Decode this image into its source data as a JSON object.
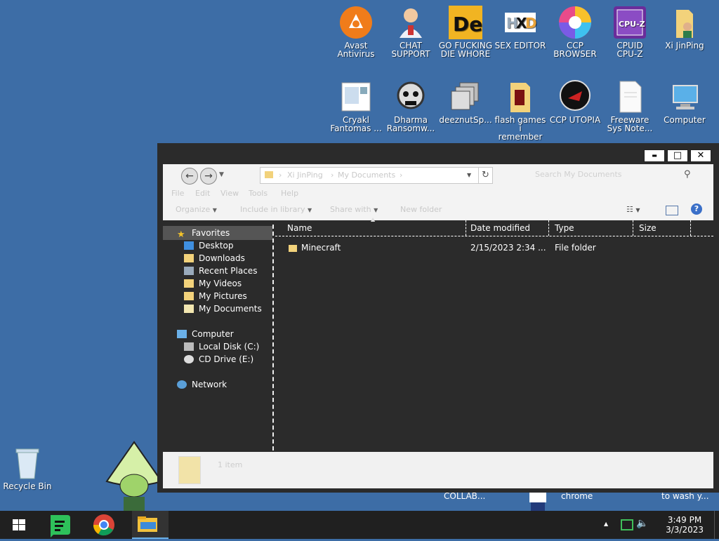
{
  "desktop_icons": [
    {
      "name": "avast-icon",
      "label": "Avast\nAntivirus"
    },
    {
      "name": "chat-support-icon",
      "label": "CHAT\nSUPPORT"
    },
    {
      "name": "de-app-icon",
      "label": "GO FUCKING\nDIE WHORE"
    },
    {
      "name": "sex-editor-icon",
      "label": "SEX EDITOR"
    },
    {
      "name": "ccp-browser-icon",
      "label": "CCP\nBROWSER"
    },
    {
      "name": "cpuz-icon",
      "label": "CPUID\nCPU-Z"
    },
    {
      "name": "xi-jinping-folder-icon",
      "label": "Xi JinPing"
    },
    {
      "name": "cryakl-icon",
      "label": "Cryakl\nFantomas ..."
    },
    {
      "name": "dharma-icon",
      "label": "Dharma\nRansomw..."
    },
    {
      "name": "deeznut-icon",
      "label": "deeznutSp..."
    },
    {
      "name": "flash-games-folder-icon",
      "label": "flash games i\nremember"
    },
    {
      "name": "ccp-utopia-icon",
      "label": "CCP UTOPIA"
    },
    {
      "name": "freeware-notes-icon",
      "label": "Freeware\nSys Note..."
    },
    {
      "name": "computer-icon",
      "label": "Computer"
    }
  ],
  "recycle_bin": {
    "label": "Recycle Bin"
  },
  "behind_labels": {
    "a": "COLLAB...",
    "b": "chrome",
    "c": "to wash y..."
  },
  "window": {
    "controls": {
      "minimize": "▬",
      "maximize": "□",
      "close": "✕"
    },
    "address": {
      "seg1": "Xi JinPing",
      "seg2": "My Documents"
    },
    "search_placeholder": "Search My Documents",
    "menu": [
      "File",
      "Edit",
      "View",
      "Tools",
      "Help"
    ],
    "toolbar": {
      "organize": "Organize",
      "include": "Include in library",
      "share": "Share with",
      "new_folder": "New folder"
    },
    "nav": {
      "favorites": "Favorites",
      "desktop": "Desktop",
      "downloads": "Downloads",
      "recent": "Recent Places",
      "videos": "My Videos",
      "pictures": "My Pictures",
      "documents": "My Documents",
      "computer": "Computer",
      "local_disk": "Local Disk (C:)",
      "cd_drive": "CD Drive (E:)",
      "network": "Network"
    },
    "columns": {
      "name": "Name",
      "date": "Date modified",
      "type": "Type",
      "size": "Size"
    },
    "files": [
      {
        "name": "Minecraft",
        "date": "2/15/2023 2:34 ...",
        "type": "File folder",
        "size": ""
      }
    ],
    "status": "1 item"
  },
  "taskbar": {
    "time": "3:49 PM",
    "date": "3/3/2023"
  },
  "colors": {
    "desktop": "#3d6da6",
    "window_dark": "#2b2b2b",
    "taskbar": "#202020"
  }
}
